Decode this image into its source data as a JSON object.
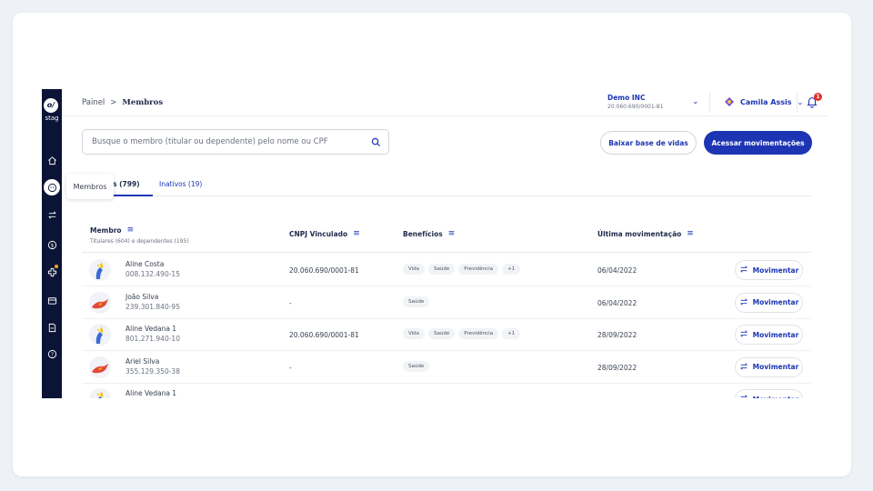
{
  "sidebar": {
    "logo_text": "stag",
    "logo_mark": "o/",
    "icons": [
      "home-icon",
      "members-icon",
      "transfer-icon",
      "dollar-icon",
      "health-cross-icon",
      "wallet-icon",
      "document-icon",
      "help-icon"
    ],
    "tooltip": "Membros",
    "notification_dot_color": "#f5a524"
  },
  "header": {
    "breadcrumb_root": "Painel",
    "breadcrumb_sep": ">",
    "breadcrumb_current": "Membros",
    "company_name": "Demo INC",
    "company_doc": "20.060.690/0001-81",
    "user_name": "Camila Assis",
    "notification_count": "1"
  },
  "search": {
    "placeholder": "Busque o membro (titular ou dependente) pelo nome ou CPF"
  },
  "actions": {
    "download_label": "Baixar base de vidas",
    "access_label": "Acessar movimentações"
  },
  "tabs": {
    "active_label": "s (799)",
    "inactive_label": "Inativos (19)"
  },
  "table": {
    "col_member": "Membro",
    "col_member_sub": "Titulares (604) e dependentes (195)",
    "col_cnpj": "CNPJ Vinculado",
    "col_benefits": "Benefícios",
    "col_last": "Última movimentação",
    "action_label": "Movimentar",
    "rows": [
      {
        "name": "Aline Costa",
        "doc": "008.132.490-15",
        "cnpj": "20.060.690/0001-81",
        "benefits": [
          "Vida",
          "Saúde",
          "Previdência",
          "+1"
        ],
        "date": "06/04/2022",
        "avatar": "unicorn"
      },
      {
        "name": "João Silva",
        "doc": "239.301.840-95",
        "cnpj": "-",
        "benefits": [
          "Saúde"
        ],
        "date": "06/04/2022",
        "avatar": "bird"
      },
      {
        "name": "Aline Vedana 1",
        "doc": "801.271.940-10",
        "cnpj": "20.060.690/0001-81",
        "benefits": [
          "Vida",
          "Saúde",
          "Previdência",
          "+1"
        ],
        "date": "28/09/2022",
        "avatar": "unicorn"
      },
      {
        "name": "Ariel Silva",
        "doc": "355.129.350-38",
        "cnpj": "-",
        "benefits": [
          "Saúde"
        ],
        "date": "28/09/2022",
        "avatar": "bird"
      },
      {
        "name": "Aline Vedana 1",
        "doc": "",
        "cnpj": "",
        "benefits": [],
        "date": "",
        "avatar": "unicorn"
      }
    ]
  },
  "colors": {
    "primary": "#1d35b3",
    "sidebar": "#0b1436",
    "badge": "#e5312b"
  }
}
